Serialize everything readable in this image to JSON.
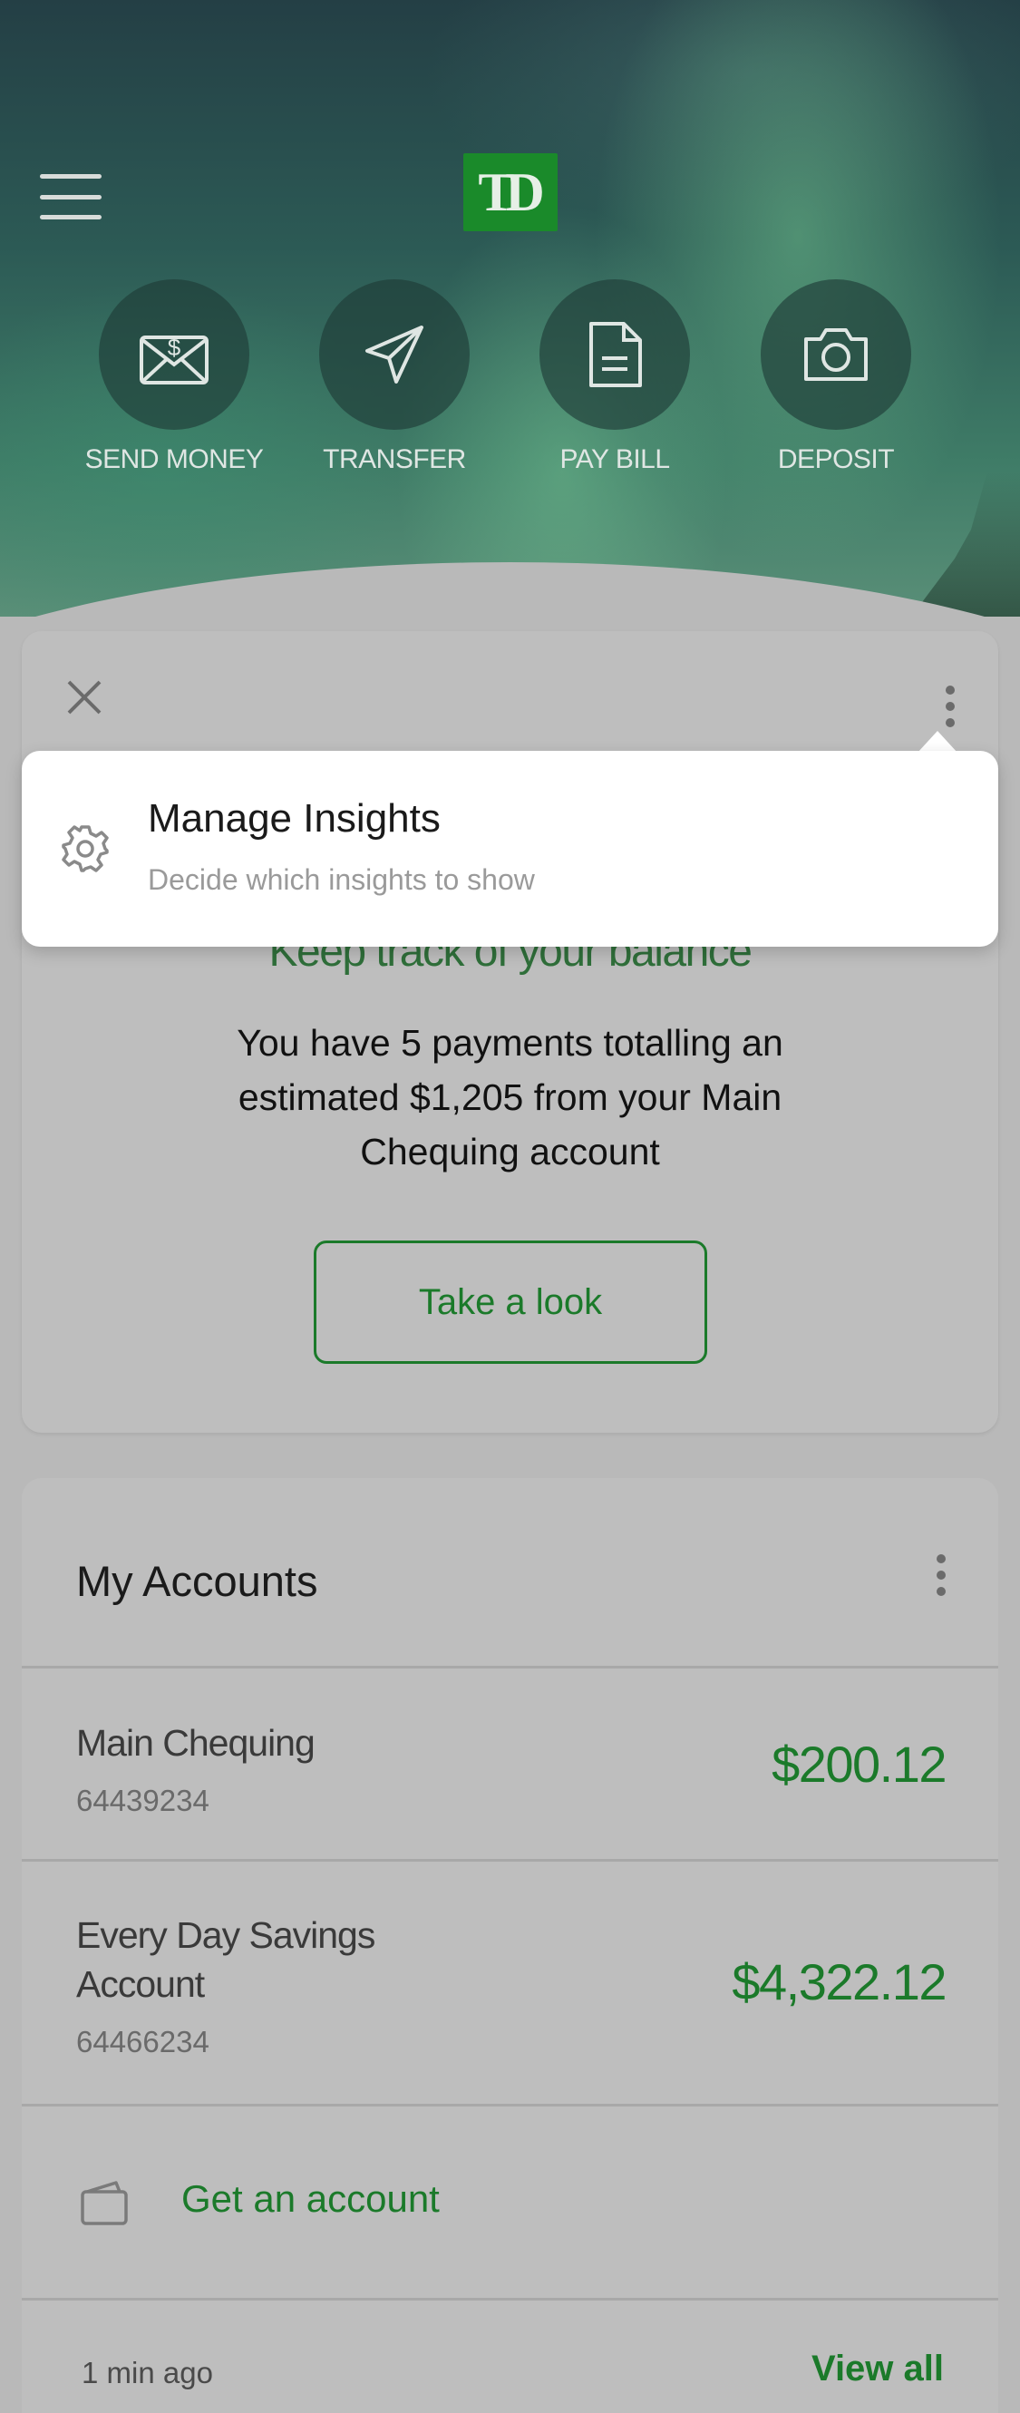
{
  "header": {
    "logo_text": "TD",
    "menu_icon": "hamburger-menu-icon",
    "actions": [
      {
        "label": "SEND MONEY",
        "icon": "envelope-dollar-icon"
      },
      {
        "label": "TRANSFER",
        "icon": "paper-plane-icon"
      },
      {
        "label": "PAY BILL",
        "icon": "document-icon"
      },
      {
        "label": "DEPOSIT",
        "icon": "camera-icon"
      }
    ]
  },
  "insight": {
    "close_icon": "close-icon",
    "more_icon": "more-vertical-icon",
    "title": "Keep track of your balance",
    "body": "You have 5 payments totalling an estimated $1,205 from your Main Chequing account",
    "cta": "Take a look"
  },
  "popover": {
    "icon": "gear-icon",
    "title": "Manage Insights",
    "subtitle": "Decide which insights to show"
  },
  "accounts": {
    "title": "My Accounts",
    "more_icon": "more-vertical-icon",
    "items": [
      {
        "name": "Main Chequing",
        "number": "64439234",
        "balance": "$200.12"
      },
      {
        "name": "Every Day Savings Account",
        "number": "64466234",
        "balance": "$4,322.12"
      }
    ],
    "get_account_icon": "wallet-icon",
    "get_account": "Get an account",
    "updated": "1 min ago",
    "view_all": "View all"
  },
  "colors": {
    "brand_green": "#1b7a2a",
    "logo_green": "#1a8a2a",
    "overlay_gray": "#b9b9b9"
  }
}
